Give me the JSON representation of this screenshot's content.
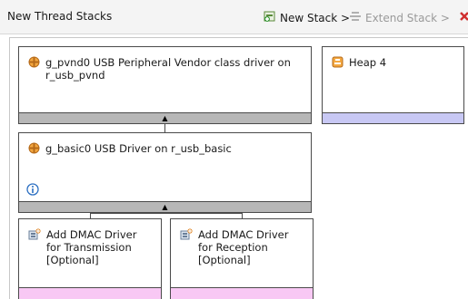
{
  "toolbar": {
    "title": "New Thread Stacks",
    "new_stack_label": "New Stack >",
    "extend_stack_label": "Extend Stack >"
  },
  "stacks": {
    "pvnd": {
      "label": "g_pvnd0 USB Peripheral Vendor class driver on r_usb_pvnd"
    },
    "heap": {
      "label": "Heap 4"
    },
    "basic": {
      "label": "g_basic0 USB Driver on r_usb_basic"
    },
    "dmac_tx": {
      "label": "Add DMAC Driver for Transmission [Optional]"
    },
    "dmac_rx": {
      "label": "Add DMAC Driver for Reception [Optional]"
    }
  },
  "icons": {
    "module": "module-icon",
    "heap": "heap-icon",
    "add": "add-module-icon",
    "info": "info-icon"
  },
  "colors": {
    "strip_gray": "#b7b7b7",
    "strip_blue": "#c8c8f4",
    "strip_pink": "#f8c8f4",
    "module_icon": "#e08a2e"
  }
}
